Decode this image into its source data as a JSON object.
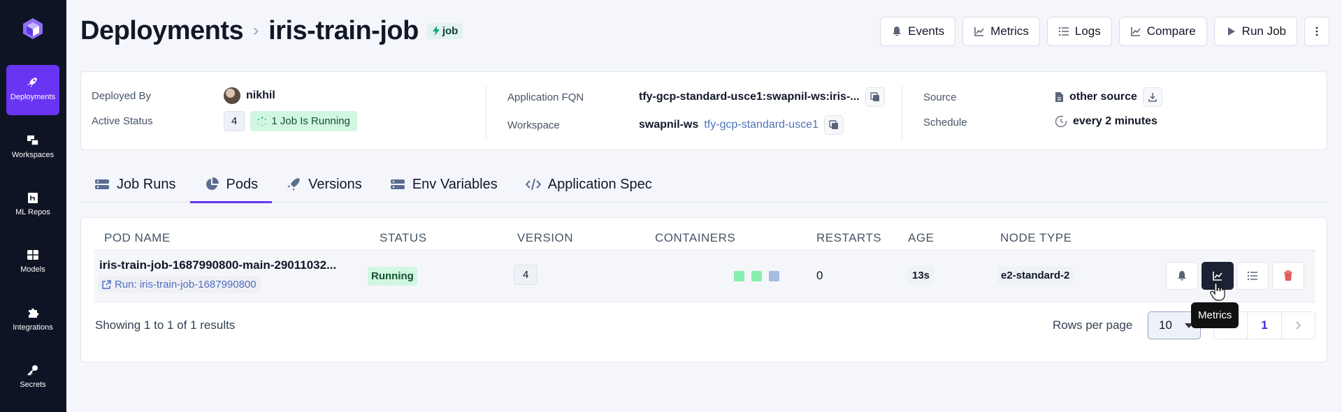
{
  "sidebar": {
    "items": [
      {
        "label": "Deployments",
        "icon": "rocket-icon",
        "active": true
      },
      {
        "label": "Workspaces",
        "icon": "workspaces-icon"
      },
      {
        "label": "ML Repos",
        "icon": "ml-repos-icon"
      },
      {
        "label": "Models",
        "icon": "models-icon"
      },
      {
        "label": "Integrations",
        "icon": "puzzle-icon"
      },
      {
        "label": "Secrets",
        "icon": "key-icon"
      }
    ]
  },
  "header": {
    "breadcrumb_root": "Deployments",
    "separator": "›",
    "title": "iris-train-job",
    "badge": "job",
    "actions": [
      "Events",
      "Metrics",
      "Logs",
      "Compare",
      "Run Job"
    ]
  },
  "info": {
    "deployed_by_label": "Deployed By",
    "deployed_by": "nikhil",
    "active_status_label": "Active Status",
    "active_count": "4",
    "running_text": "1 Job Is Running",
    "fqn_label": "Application FQN",
    "fqn": "tfy-gcp-standard-usce1:swapnil-ws:iris-...",
    "workspace_label": "Workspace",
    "workspace": "swapnil-ws",
    "workspace_cluster": "tfy-gcp-standard-usce1",
    "source_label": "Source",
    "source": "other source",
    "schedule_label": "Schedule",
    "schedule": "every 2 minutes"
  },
  "tabs": [
    "Job Runs",
    "Pods",
    "Versions",
    "Env Variables",
    "Application Spec"
  ],
  "active_tab": "Pods",
  "table": {
    "headers": [
      "POD NAME",
      "STATUS",
      "VERSION",
      "CONTAINERS",
      "RESTARTS",
      "AGE",
      "NODE TYPE"
    ],
    "rows": [
      {
        "pod_name": "iris-train-job-1687990800-main-29011032...",
        "run_link": "Run: iris-train-job-1687990800",
        "status": "Running",
        "version": "4",
        "containers": [
          "#86efac",
          "#86efac",
          "#a5bde0"
        ],
        "restarts": "0",
        "age": "13s",
        "node_type": "e2-standard-2"
      }
    ]
  },
  "tooltip": "Metrics",
  "pagination": {
    "showing": "Showing 1 to 1 of 1 results",
    "rows_per_page_label": "Rows per page",
    "rows_per_page": "10",
    "current_page": "1"
  },
  "colors": {
    "sidebar_bg": "#0e1424",
    "accent": "#6a35f2",
    "running_bg": "#d1f7e2"
  }
}
